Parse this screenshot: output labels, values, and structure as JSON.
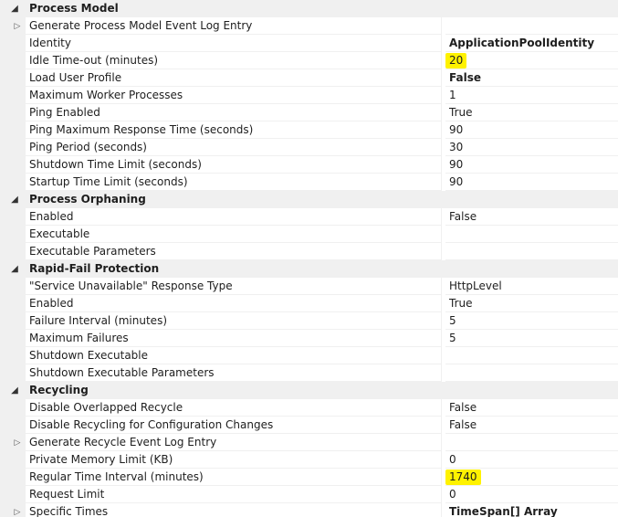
{
  "categories": [
    {
      "title": "Process Model",
      "rows": [
        {
          "name": "Generate Process Model Event Log Entry",
          "value": "",
          "expandable": true
        },
        {
          "name": "Identity",
          "value": "ApplicationPoolIdentity",
          "bold": true
        },
        {
          "name": "Idle Time-out (minutes)",
          "value": "20",
          "highlight": true
        },
        {
          "name": "Load User Profile",
          "value": "False",
          "bold": true
        },
        {
          "name": "Maximum Worker Processes",
          "value": "1"
        },
        {
          "name": "Ping Enabled",
          "value": "True"
        },
        {
          "name": "Ping Maximum Response Time (seconds)",
          "value": "90"
        },
        {
          "name": "Ping Period (seconds)",
          "value": "30"
        },
        {
          "name": "Shutdown Time Limit (seconds)",
          "value": "90"
        },
        {
          "name": "Startup Time Limit (seconds)",
          "value": "90"
        }
      ]
    },
    {
      "title": "Process Orphaning",
      "rows": [
        {
          "name": "Enabled",
          "value": "False"
        },
        {
          "name": "Executable",
          "value": ""
        },
        {
          "name": "Executable Parameters",
          "value": ""
        }
      ]
    },
    {
      "title": "Rapid-Fail Protection",
      "rows": [
        {
          "name": "\"Service Unavailable\" Response Type",
          "value": "HttpLevel"
        },
        {
          "name": "Enabled",
          "value": "True"
        },
        {
          "name": "Failure Interval (minutes)",
          "value": "5"
        },
        {
          "name": "Maximum Failures",
          "value": "5"
        },
        {
          "name": "Shutdown Executable",
          "value": ""
        },
        {
          "name": "Shutdown Executable Parameters",
          "value": ""
        }
      ]
    },
    {
      "title": "Recycling",
      "rows": [
        {
          "name": "Disable Overlapped Recycle",
          "value": "False"
        },
        {
          "name": "Disable Recycling for Configuration Changes",
          "value": "False"
        },
        {
          "name": "Generate Recycle Event Log Entry",
          "value": "",
          "expandable": true
        },
        {
          "name": "Private Memory Limit (KB)",
          "value": "0"
        },
        {
          "name": "Regular Time Interval (minutes)",
          "value": "1740",
          "highlight": true
        },
        {
          "name": "Request Limit",
          "value": "0"
        },
        {
          "name": "Specific Times",
          "value": "TimeSpan[] Array",
          "bold": true,
          "expandable": true
        }
      ]
    }
  ],
  "icons": {
    "collapse": "collapse-triangle-icon",
    "expand": "expand-triangle-icon"
  },
  "colors": {
    "gutter": "#f0f0f0",
    "highlight": "#fff200",
    "gridline": "#f0f0f0"
  }
}
